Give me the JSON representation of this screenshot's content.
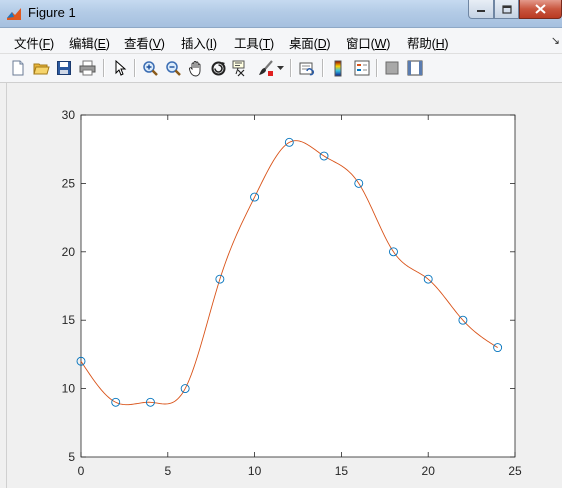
{
  "window": {
    "title": "Figure 1"
  },
  "menu": {
    "items": [
      {
        "label": "文件(",
        "key": "F",
        "end": ")"
      },
      {
        "label": "编辑(",
        "key": "E",
        "end": ")"
      },
      {
        "label": "查看(",
        "key": "V",
        "end": ")"
      },
      {
        "label": "插入(",
        "key": "I",
        "end": ")"
      },
      {
        "label": "工具(",
        "key": "T",
        "end": ")"
      },
      {
        "label": "桌面(",
        "key": "D",
        "end": ")"
      },
      {
        "label": "窗口(",
        "key": "W",
        "end": ")"
      },
      {
        "label": "帮助(",
        "key": "H",
        "end": ")"
      }
    ]
  },
  "toolbar": {
    "icons": [
      "new-figure-icon",
      "open-file-icon",
      "save-icon",
      "print-icon",
      "pointer-icon",
      "zoom-in-icon",
      "zoom-out-icon",
      "pan-hand-icon",
      "rotate-3d-icon",
      "data-cursor-icon",
      "brush-icon",
      "brush-dropdown-icon",
      "link-plot-icon",
      "colorbar-icon",
      "legend-icon",
      "hide-plot-tools-icon",
      "show-plot-tools-icon"
    ]
  },
  "colors": {
    "marker": "#0072bd",
    "curve": "#d95319",
    "axes": "#262626",
    "title_bar": "#b3cbe6",
    "close_button": "#c9563f"
  },
  "chart_data": {
    "type": "line",
    "title": "",
    "xlabel": "",
    "ylabel": "",
    "xlim": [
      0,
      25
    ],
    "ylim": [
      5,
      30
    ],
    "xticks": [
      0,
      5,
      10,
      15,
      20,
      25
    ],
    "yticks": [
      5,
      10,
      15,
      20,
      25,
      30
    ],
    "grid": false,
    "series": [
      {
        "style": "markers",
        "marker": "circle",
        "color": "#0072bd",
        "x": [
          0,
          2,
          4,
          6,
          8,
          10,
          12,
          14,
          16,
          18,
          20,
          22,
          24
        ],
        "y": [
          12,
          9,
          9,
          10,
          18,
          24,
          28,
          27,
          25,
          20,
          18,
          15,
          13
        ]
      },
      {
        "style": "line",
        "interpolation": "spline",
        "color": "#d95319",
        "x": [
          0,
          2,
          4,
          6,
          8,
          10,
          12,
          14,
          16,
          18,
          20,
          22,
          24
        ],
        "y": [
          12,
          9,
          9,
          10,
          18,
          24,
          28,
          27,
          25,
          20,
          18,
          15,
          13
        ]
      }
    ]
  }
}
